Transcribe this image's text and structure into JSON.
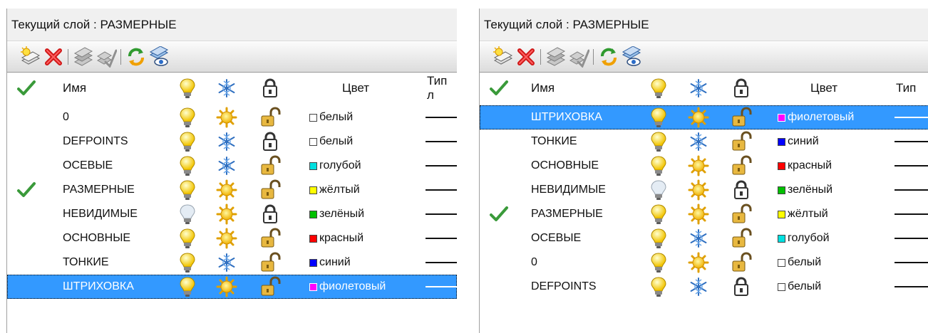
{
  "colors": {
    "selection": "#3399ff",
    "check": "#3a9a3a"
  },
  "panels": [
    {
      "title": "Текущий слой : РАЗМЕРНЫЕ",
      "toolbar": [
        "new-layer-icon",
        "delete-layer-icon",
        "set-current-icon",
        "isolate-icon",
        "refresh-icon",
        "layer-states-icon"
      ],
      "header": {
        "name": "Имя",
        "color": "Цвет",
        "linetype": "Тип л"
      },
      "rows": [
        {
          "current": false,
          "name": "0",
          "on": true,
          "frozen": false,
          "locked": false,
          "color_name": "белый",
          "swatch": "#ffffff",
          "selected": false
        },
        {
          "current": false,
          "name": "DEFPOINTS",
          "on": true,
          "frozen": true,
          "locked": true,
          "color_name": "белый",
          "swatch": "#ffffff",
          "selected": false
        },
        {
          "current": false,
          "name": "ОСЕВЫЕ",
          "on": true,
          "frozen": true,
          "locked": false,
          "color_name": "голубой",
          "swatch": "#00e0e0",
          "selected": false
        },
        {
          "current": true,
          "name": "РАЗМЕРНЫЕ",
          "on": true,
          "frozen": false,
          "locked": false,
          "color_name": "жёлтый",
          "swatch": "#ffff00",
          "selected": false
        },
        {
          "current": false,
          "name": "НЕВИДИМЫЕ",
          "on": false,
          "frozen": false,
          "locked": true,
          "color_name": "зелёный",
          "swatch": "#00c000",
          "selected": false
        },
        {
          "current": false,
          "name": "ОСНОВНЫЕ",
          "on": true,
          "frozen": false,
          "locked": false,
          "color_name": "красный",
          "swatch": "#ff0000",
          "selected": false
        },
        {
          "current": false,
          "name": "ТОНКИЕ",
          "on": true,
          "frozen": true,
          "locked": false,
          "color_name": "синий",
          "swatch": "#0000ff",
          "selected": false
        },
        {
          "current": false,
          "name": "ШТРИХОВКА",
          "on": true,
          "frozen": false,
          "locked": false,
          "color_name": "фиолетовый",
          "swatch": "#ff00ff",
          "selected": true
        }
      ]
    },
    {
      "title": "Текущий слой : РАЗМЕРНЫЕ",
      "toolbar": [
        "new-layer-icon",
        "delete-layer-icon",
        "set-current-icon",
        "isolate-icon",
        "refresh-icon",
        "layer-states-icon"
      ],
      "header": {
        "name": "Имя",
        "color": "Цвет",
        "linetype": "Тип"
      },
      "rows": [
        {
          "current": false,
          "name": "ШТРИХОВКА",
          "on": true,
          "frozen": false,
          "locked": false,
          "color_name": "фиолетовый",
          "swatch": "#ff00ff",
          "selected": true
        },
        {
          "current": false,
          "name": "ТОНКИЕ",
          "on": true,
          "frozen": true,
          "locked": false,
          "color_name": "синий",
          "swatch": "#0000ff",
          "selected": false
        },
        {
          "current": false,
          "name": "ОСНОВНЫЕ",
          "on": true,
          "frozen": false,
          "locked": false,
          "color_name": "красный",
          "swatch": "#ff0000",
          "selected": false
        },
        {
          "current": false,
          "name": "НЕВИДИМЫЕ",
          "on": false,
          "frozen": false,
          "locked": true,
          "color_name": "зелёный",
          "swatch": "#00c000",
          "selected": false
        },
        {
          "current": true,
          "name": "РАЗМЕРНЫЕ",
          "on": true,
          "frozen": false,
          "locked": false,
          "color_name": "жёлтый",
          "swatch": "#ffff00",
          "selected": false
        },
        {
          "current": false,
          "name": "ОСЕВЫЕ",
          "on": true,
          "frozen": true,
          "locked": false,
          "color_name": "голубой",
          "swatch": "#00e0e0",
          "selected": false
        },
        {
          "current": false,
          "name": "0",
          "on": true,
          "frozen": false,
          "locked": false,
          "color_name": "белый",
          "swatch": "#ffffff",
          "selected": false
        },
        {
          "current": false,
          "name": "DEFPOINTS",
          "on": true,
          "frozen": true,
          "locked": true,
          "color_name": "белый",
          "swatch": "#ffffff",
          "selected": false
        }
      ]
    }
  ]
}
